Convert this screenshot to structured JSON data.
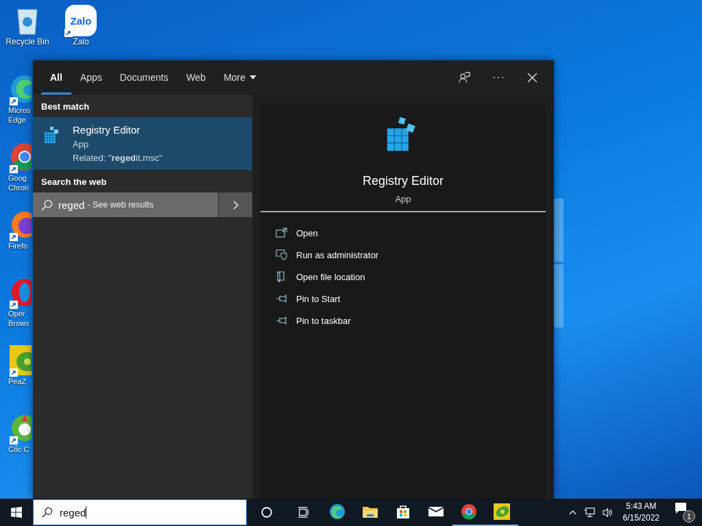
{
  "desktop_icons": [
    {
      "kind": "recycle",
      "label_lines": [
        "Recycle Bin"
      ],
      "shortcut": false
    },
    {
      "kind": "zalo",
      "label_lines": [
        "Zalo"
      ],
      "shortcut": true,
      "logo_text": "Zalo"
    },
    {
      "kind": "edge",
      "label_lines": [
        "Micros",
        "Edge"
      ],
      "shortcut": true
    },
    {
      "kind": "chrome",
      "label_lines": [
        "Goog",
        "Chron"
      ],
      "shortcut": true
    },
    {
      "kind": "firefox",
      "label_lines": [
        "Firefo"
      ],
      "shortcut": true
    },
    {
      "kind": "opera",
      "label_lines": [
        "Oper",
        "Brows"
      ],
      "shortcut": true
    },
    {
      "kind": "peazip",
      "label_lines": [
        "PeaZ"
      ],
      "shortcut": true
    },
    {
      "kind": "coccoc",
      "label_lines": [
        "Cốc C"
      ],
      "shortcut": true
    }
  ],
  "search_panel": {
    "tabs": [
      {
        "label": "All",
        "selected": true,
        "dropdown": false
      },
      {
        "label": "Apps",
        "selected": false,
        "dropdown": false
      },
      {
        "label": "Documents",
        "selected": false,
        "dropdown": false
      },
      {
        "label": "Web",
        "selected": false,
        "dropdown": false
      },
      {
        "label": "More",
        "selected": false,
        "dropdown": true
      }
    ],
    "more_options": "···",
    "best_match": {
      "heading": "Best match",
      "title": "Registry Editor",
      "type": "App",
      "related": "Related: \"**reged**it.msc\"",
      "selected": true
    },
    "web": {
      "heading": "Search the web",
      "query": "reged",
      "hint": "- See web results"
    },
    "preview": {
      "title": "Registry Editor",
      "type": "App",
      "actions": [
        {
          "kind": "open",
          "label": "Open"
        },
        {
          "kind": "admin",
          "label": "Run as administrator"
        },
        {
          "kind": "folder",
          "label": "Open file location"
        },
        {
          "kind": "pin",
          "label": "Pin to Start"
        },
        {
          "kind": "pin",
          "label": "Pin to taskbar"
        }
      ]
    }
  },
  "taskbar": {
    "search_value": "reged",
    "apps": [
      {
        "kind": "edge",
        "running": false
      },
      {
        "kind": "explorer",
        "running": false
      },
      {
        "kind": "store",
        "running": false
      },
      {
        "kind": "mail",
        "running": false
      },
      {
        "kind": "chrome",
        "running": true
      },
      {
        "kind": "peazip",
        "running": true
      }
    ],
    "time": "5:43 AM",
    "date": "6/15/2022",
    "notification_count": "1"
  }
}
